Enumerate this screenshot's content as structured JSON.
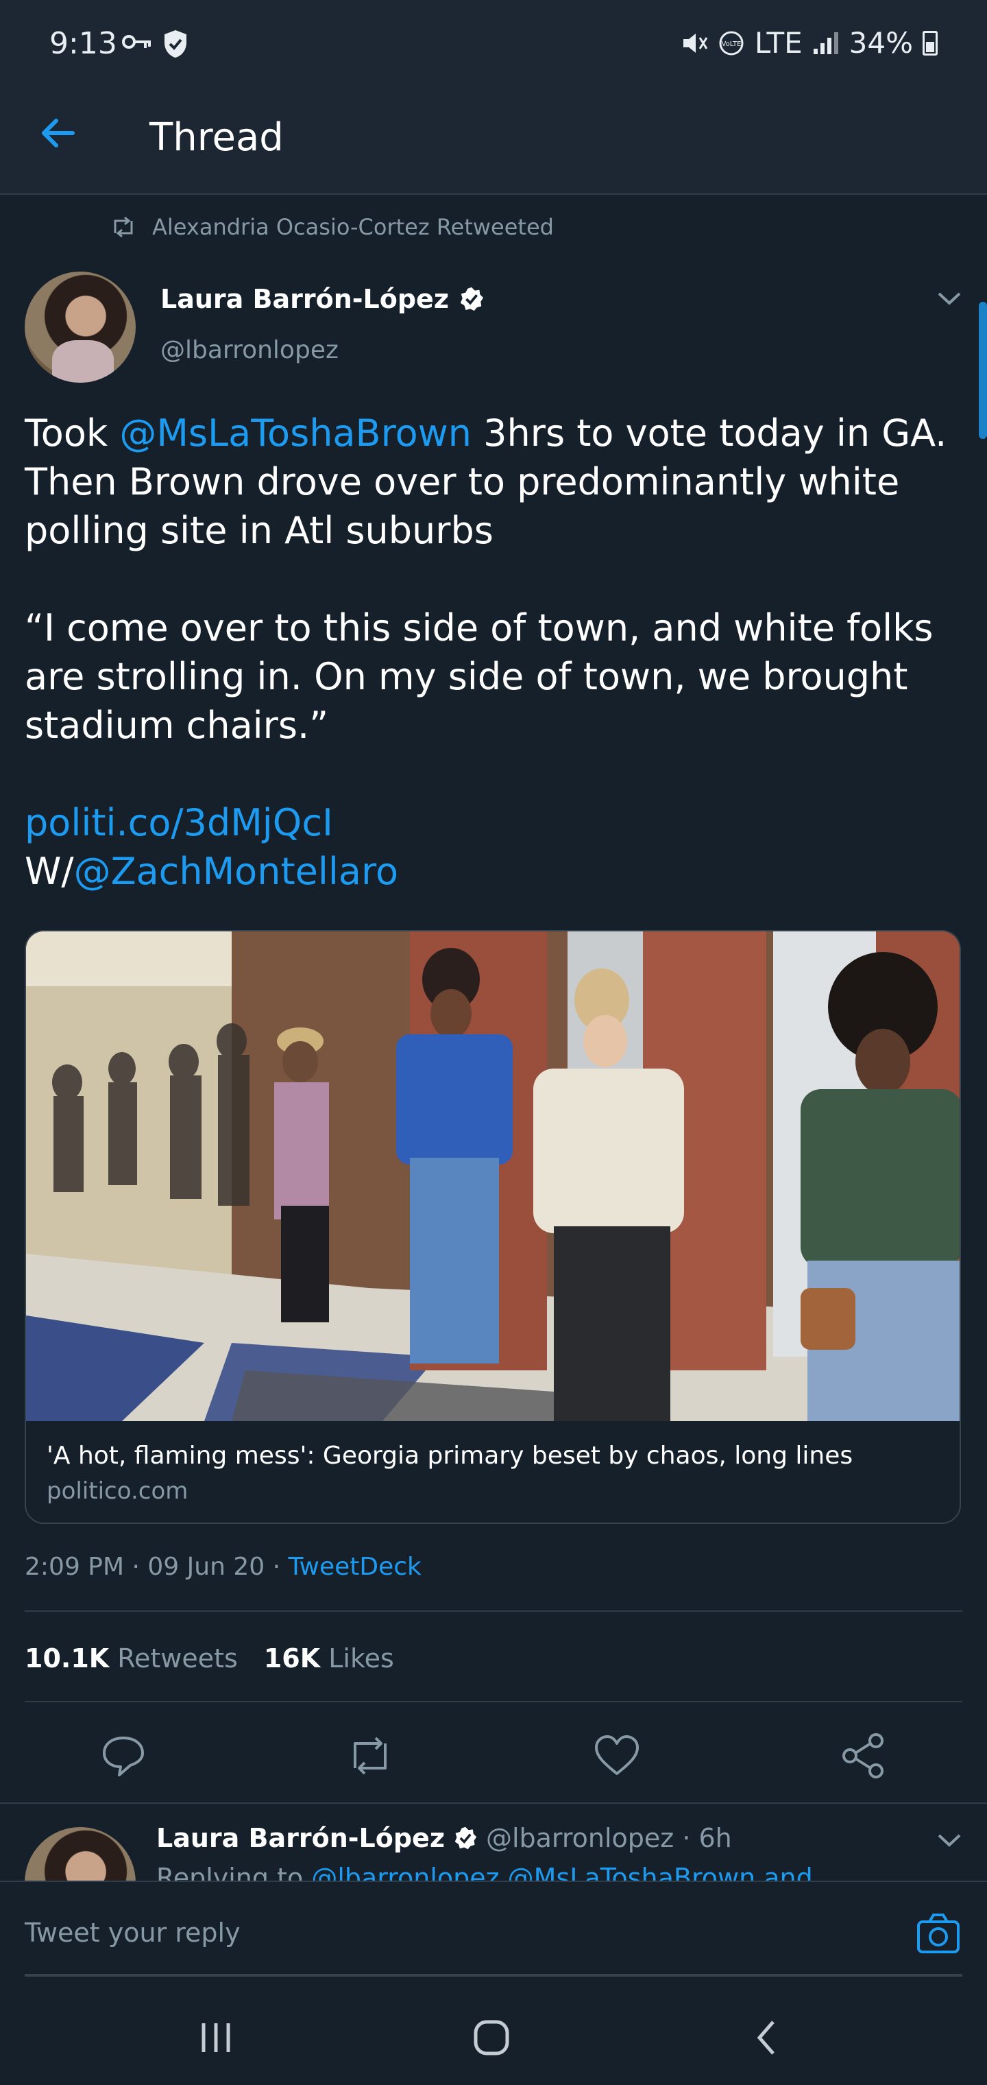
{
  "status_bar": {
    "time": "9:13",
    "battery": "34%",
    "network": "LTE"
  },
  "header": {
    "title": "Thread"
  },
  "tweet": {
    "retweeted_by": "Alexandria Ocasio-Cortez Retweeted",
    "author_name": "Laura Barrón-López",
    "author_handle": "@lbarronlopez",
    "text": {
      "p1_pre": "Took ",
      "p1_mention": "@MsLaToshaBrown",
      "p1_post": " 3hrs to vote today in GA. Then Brown drove over to predominantly white polling site in Atl suburbs",
      "p2": "“I come over to this side of town, and white folks are strolling in. On my side of town, we brought stadium chairs.”",
      "link": "politi.co/3dMjQcI",
      "w_prefix": "W/",
      "w_mention": "@ZachMontellaro"
    },
    "card": {
      "title": "'A hot, flaming mess': Georgia primary beset by chaos, long lines",
      "domain": "politico.com"
    },
    "meta": {
      "time": "2:09 PM · 09 Jun 20 · ",
      "source": "TweetDeck"
    },
    "stats": {
      "retweets_count": "10.1K",
      "retweets_label": "Retweets",
      "likes_count": "16K",
      "likes_label": "Likes"
    }
  },
  "reply": {
    "author_name": "Laura Barrón-López",
    "author_handle": "@lbarronlopez · 6h",
    "replying_prefix": "Replying to ",
    "replying_to": "@lbarronlopez @MsLaToshaBrown and"
  },
  "composer": {
    "placeholder": "Tweet your reply"
  },
  "colors": {
    "background": "#15202b",
    "accent": "#1d9bf0",
    "muted": "#8899a6"
  }
}
